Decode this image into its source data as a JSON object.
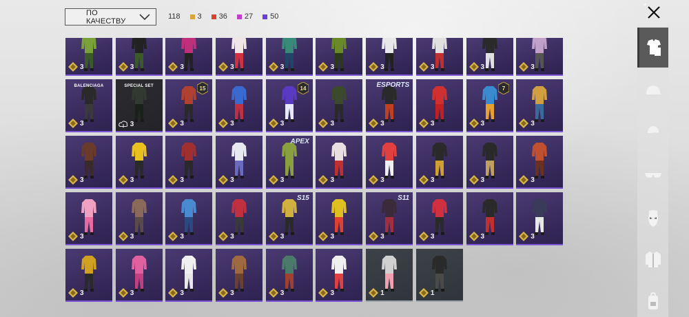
{
  "sort": {
    "label": "ПО КАЧЕСТВУ"
  },
  "counts": {
    "total": "118",
    "by_rarity": [
      {
        "value": "3",
        "color": "#d9a53a"
      },
      {
        "value": "36",
        "color": "#d8432f"
      },
      {
        "value": "27",
        "color": "#c23dcb"
      },
      {
        "value": "50",
        "color": "#6a3fd6"
      }
    ]
  },
  "grid": {
    "rows": [
      [
        {
          "qty": "3",
          "colors": [
            "#7aa03a",
            "#3a5a2a"
          ]
        },
        {
          "qty": "3",
          "colors": [
            "#222",
            "#3a5a2a"
          ]
        },
        {
          "qty": "3",
          "colors": [
            "#c0307a",
            "#222"
          ]
        },
        {
          "qty": "3",
          "colors": [
            "#f0e6e6",
            "#d03040"
          ]
        },
        {
          "qty": "3",
          "colors": [
            "#3a8a7a",
            "#224466"
          ]
        },
        {
          "qty": "3",
          "colors": [
            "#6a8a2a",
            "#2a3a1a"
          ]
        },
        {
          "qty": "3",
          "colors": [
            "#e8e8e8",
            "#222"
          ]
        },
        {
          "qty": "3",
          "colors": [
            "#e0e0e0",
            "#c03030"
          ]
        },
        {
          "qty": "3",
          "colors": [
            "#2a2a2a",
            "#e0e0e0"
          ]
        },
        {
          "qty": "3",
          "colors": [
            "#c0a0c8",
            "#555"
          ]
        }
      ],
      [
        {
          "qty": "3",
          "colors": [
            "#2a2a2a",
            "#3a3a3a"
          ],
          "brand": "BALENCIAGA"
        },
        {
          "qty": "3",
          "colors": [
            "#303a30",
            "#1a201a"
          ],
          "dark": true,
          "cloud": true,
          "brand": "SPECIAL SET"
        },
        {
          "qty": "3",
          "colors": [
            "#b04030",
            "#2a2a2a"
          ],
          "badge": "15"
        },
        {
          "qty": "3",
          "colors": [
            "#3a6ad0",
            "#c03040"
          ]
        },
        {
          "qty": "3",
          "colors": [
            "#5a3ac0",
            "#e8e8ff"
          ],
          "badge": "14"
        },
        {
          "qty": "3",
          "colors": [
            "#3a4a2a",
            "#2a2a2a"
          ]
        },
        {
          "qty": "3",
          "colors": [
            "#2a2a2a",
            "#c04020"
          ],
          "tag": "ESPORTS"
        },
        {
          "qty": "3",
          "colors": [
            "#d03030",
            "#c02020"
          ]
        },
        {
          "qty": "3",
          "colors": [
            "#3a8ad0",
            "#e8a030"
          ],
          "badge": "7"
        },
        {
          "qty": "3",
          "colors": [
            "#d0a040",
            "#3a6a9a"
          ]
        }
      ],
      [
        {
          "qty": "3",
          "colors": [
            "#6a3a2a",
            "#3a2a2a"
          ]
        },
        {
          "qty": "3",
          "colors": [
            "#e8c020",
            "#2a2a2a"
          ]
        },
        {
          "qty": "3",
          "colors": [
            "#a03030",
            "#2a2a2a"
          ]
        },
        {
          "qty": "3",
          "colors": [
            "#e8e8f0",
            "#6a6ac0"
          ]
        },
        {
          "qty": "3",
          "colors": [
            "#8aa040",
            "#8aa040"
          ],
          "tag": "APEX"
        },
        {
          "qty": "3",
          "colors": [
            "#e8e0e0",
            "#c03030"
          ]
        },
        {
          "qty": "3",
          "colors": [
            "#e04040",
            "#f0f0f0"
          ]
        },
        {
          "qty": "3",
          "colors": [
            "#2a2a2a",
            "#d0a030"
          ]
        },
        {
          "qty": "3",
          "colors": [
            "#2a2a2a",
            "#c0a060"
          ]
        },
        {
          "qty": "3",
          "colors": [
            "#c05030",
            "#6a3020"
          ]
        }
      ],
      [
        {
          "qty": "3",
          "colors": [
            "#f0a0c0",
            "#e86aa0"
          ]
        },
        {
          "qty": "3",
          "colors": [
            "#8a6a5a",
            "#5a4a4a"
          ]
        },
        {
          "qty": "3",
          "colors": [
            "#4a8ad0",
            "#2a4a80"
          ]
        },
        {
          "qty": "3",
          "colors": [
            "#c03040",
            "#3a3a3a"
          ]
        },
        {
          "qty": "3",
          "colors": [
            "#d0b040",
            "#2a2a2a"
          ],
          "tag": "S15"
        },
        {
          "qty": "3",
          "colors": [
            "#e0c020",
            "#e04030"
          ]
        },
        {
          "qty": "3",
          "colors": [
            "#3a2a3a",
            "#a03040"
          ],
          "tag": "S11"
        },
        {
          "qty": "3",
          "colors": [
            "#d03040",
            "#2a2a2a"
          ]
        },
        {
          "qty": "3",
          "colors": [
            "#2a2a2a",
            "#c03030"
          ]
        },
        {
          "qty": "3",
          "colors": [
            "#3a3a5a",
            "#e8e8e8"
          ]
        }
      ],
      [
        {
          "qty": "3",
          "colors": [
            "#d0a020",
            "#2a2a2a"
          ]
        },
        {
          "qty": "3",
          "colors": [
            "#e060a0",
            "#c04080"
          ]
        },
        {
          "qty": "3",
          "colors": [
            "#f0f0f0",
            "#e8e8e8"
          ]
        },
        {
          "qty": "3",
          "colors": [
            "#a06a40",
            "#6a4030"
          ]
        },
        {
          "qty": "3",
          "colors": [
            "#4a7a6a",
            "#a04030"
          ]
        },
        {
          "qty": "3",
          "colors": [
            "#f0f0f0",
            "#e04040"
          ]
        },
        {
          "qty": "1",
          "colors": [
            "#d0d0d0",
            "#f0a0b0"
          ],
          "grey": true
        },
        {
          "qty": "1",
          "colors": [
            "#2a2a2a",
            "#4a4a4a"
          ],
          "grey": true
        }
      ]
    ]
  },
  "sidebar": {
    "items": [
      {
        "icon": "outfit-icon",
        "active": true
      },
      {
        "icon": "helmet-icon"
      },
      {
        "icon": "cap-icon"
      },
      {
        "icon": "glasses-icon"
      },
      {
        "icon": "mask-icon"
      },
      {
        "icon": "jacket-icon"
      },
      {
        "icon": "backpack-icon"
      }
    ]
  }
}
